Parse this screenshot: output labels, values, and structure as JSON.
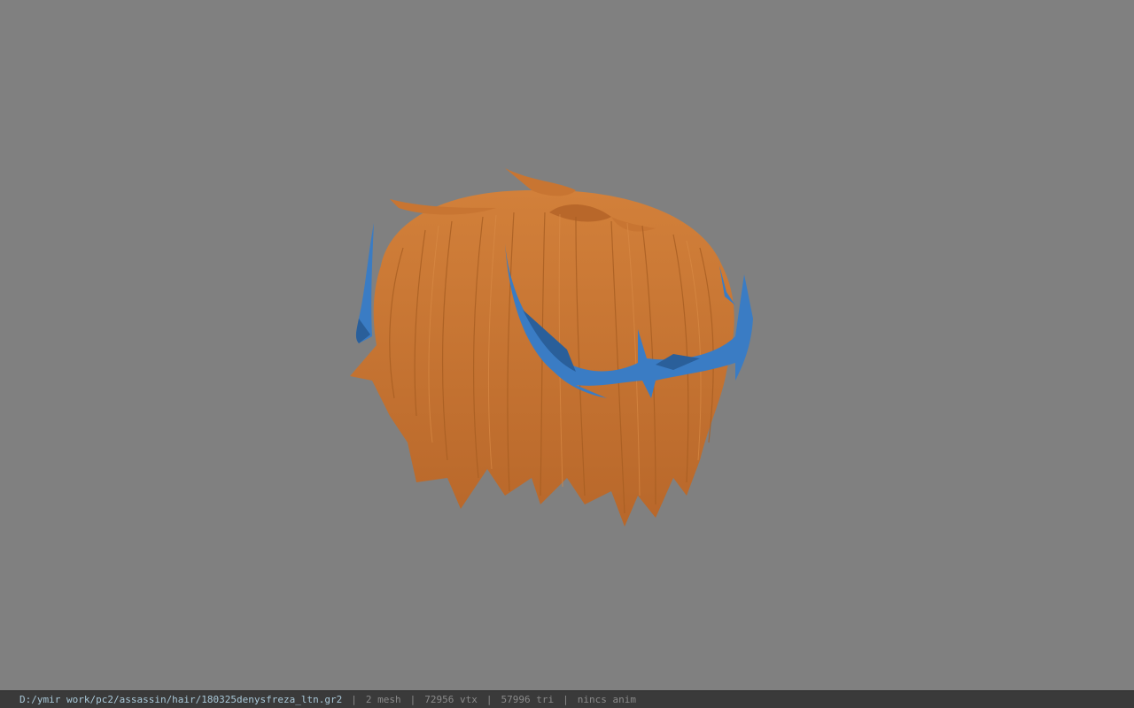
{
  "viewport": {
    "background_color": "#808080",
    "model": {
      "hair_color": "#c87532",
      "hair_shade_color": "#a85e22",
      "accessory_color": "#3a7cc4",
      "accessory_shade_color": "#2a5f9a"
    }
  },
  "status_bar": {
    "file_path": "D:/ymir work/pc2/assassin/hair/180325denysfreza_ltn.gr2",
    "separator": "|",
    "mesh_count": "2 mesh",
    "vertex_count": "72956 vtx",
    "triangle_count": "57996 tri",
    "anim_status": "nincs anim"
  }
}
